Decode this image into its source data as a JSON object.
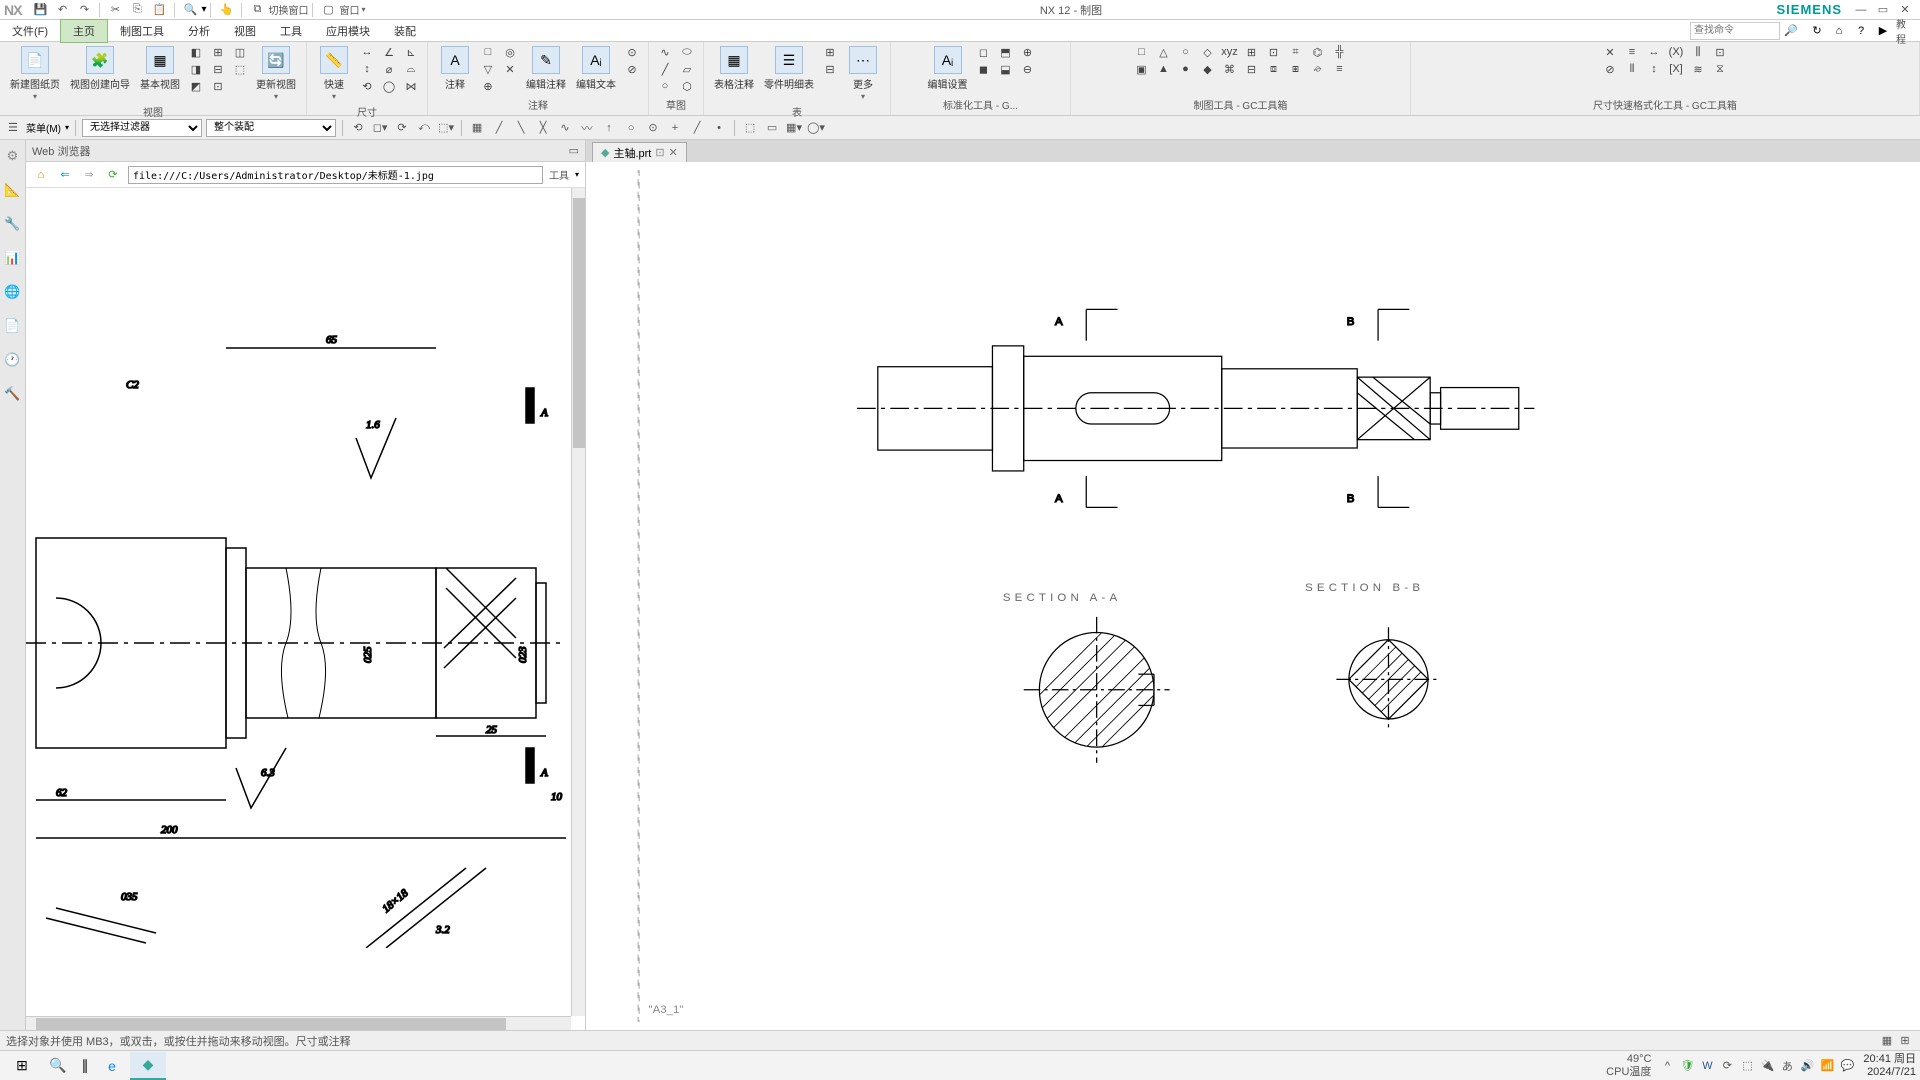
{
  "titlebar": {
    "app_logo": "NX",
    "switch_window": "切换窗口",
    "window_menu": "窗口",
    "title": "NX 12 - 制图",
    "brand": "SIEMENS"
  },
  "menubar": {
    "items": [
      "文件(F)",
      "主页",
      "制图工具",
      "分析",
      "视图",
      "工具",
      "应用模块",
      "装配"
    ],
    "active_index": 1,
    "search_placeholder": "查找命令",
    "tutorial_label": "教程"
  },
  "ribbon": {
    "groups": [
      {
        "label": "视图",
        "big_buttons": [
          {
            "label": "新建图纸页"
          },
          {
            "label": "视图创建向导"
          },
          {
            "label": "基本视图"
          },
          {
            "label": "更新视图"
          }
        ]
      },
      {
        "label": "尺寸",
        "big_buttons": [
          {
            "label": "快速"
          }
        ]
      },
      {
        "label": "注释",
        "big_buttons": [
          {
            "label": "注释"
          },
          {
            "label": "编辑注释"
          },
          {
            "label": "编辑文本"
          }
        ]
      },
      {
        "label": "草图",
        "big_buttons": []
      },
      {
        "label": "表",
        "big_buttons": [
          {
            "label": "表格注释"
          },
          {
            "label": "零件明细表"
          },
          {
            "label": "更多"
          }
        ]
      },
      {
        "label": "标准化工具 - G...",
        "big_buttons": [
          {
            "label": "编辑设置"
          }
        ]
      },
      {
        "label": "制图工具 - GC工具箱",
        "big_buttons": []
      },
      {
        "label": "尺寸快速格式化工具 - GC工具箱",
        "big_buttons": []
      }
    ]
  },
  "filterbar": {
    "menu_button": "菜单(M)",
    "filter1": "无选择过滤器",
    "filter2": "整个装配"
  },
  "web_panel": {
    "title": "Web 浏览器",
    "url": "file:///C:/Users/Administrator/Desktop/未标题-1.jpg",
    "tools_label": "工具",
    "drawing": {
      "dim_65": "65",
      "c2": "C2",
      "ra_16": "1.6",
      "a_label": "A",
      "dia_025": "025",
      "dia_023": "023",
      "dim_25": "25",
      "ra_63": "6.3",
      "dim_62": "62",
      "dim_10": "10",
      "dim_200": "200",
      "dia_035": "035",
      "dim_18x18": "18×18",
      "ra_32": "3.2"
    }
  },
  "draw_panel": {
    "tab_name": "主轴.prt",
    "section_a": "SECTION A-A",
    "section_b": "SECTION B-B",
    "label_a": "A",
    "label_b": "B",
    "sheet_label": "\"A3_1\""
  },
  "statusbar": {
    "message": "选择对象并使用 MB3，或双击，或按住并拖动来移动视图。尺寸或注释"
  },
  "taskbar": {
    "temp_value": "49°C",
    "temp_label": "CPU温度",
    "time": "20:41",
    "day": "周日",
    "date": "2024/7/21"
  }
}
